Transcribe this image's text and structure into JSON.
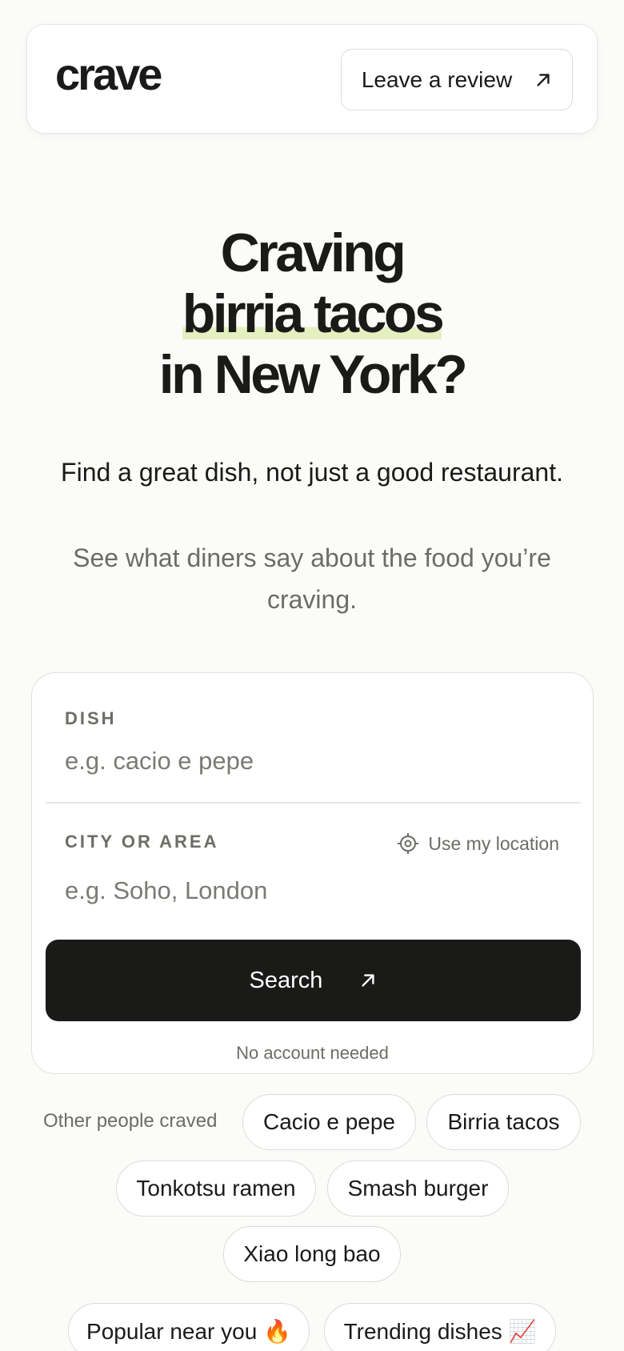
{
  "header": {
    "logo": "crave",
    "review_label": "Leave a review"
  },
  "hero": {
    "line1": "Craving",
    "line2": "birria tacos",
    "line3": "in New York?"
  },
  "subtitle": {
    "primary": "Find a great dish, not just a good restaurant.",
    "secondary": "See what diners say about the food you’re craving."
  },
  "search": {
    "dish_label": "DISH",
    "dish_placeholder": "e.g. cacio e pepe",
    "city_label": "CITY OR AREA",
    "city_placeholder": "e.g. Soho, London",
    "location_label": "Use my location",
    "button_label": "Search",
    "note": "No account needed"
  },
  "suggestions": {
    "label": "Other people craved",
    "chips": [
      "Cacio e pepe",
      "Birria tacos",
      "Tonkotsu ramen",
      "Smash burger",
      "Xiao long bao"
    ]
  },
  "bottom_chips": [
    "Popular near you 🔥",
    "Trending dishes 📈"
  ],
  "colors": {
    "background": "#fbfbf9",
    "primary_dark": "#1a1b19",
    "highlight": "#e6efc0",
    "muted_text": "#6c6d66"
  }
}
